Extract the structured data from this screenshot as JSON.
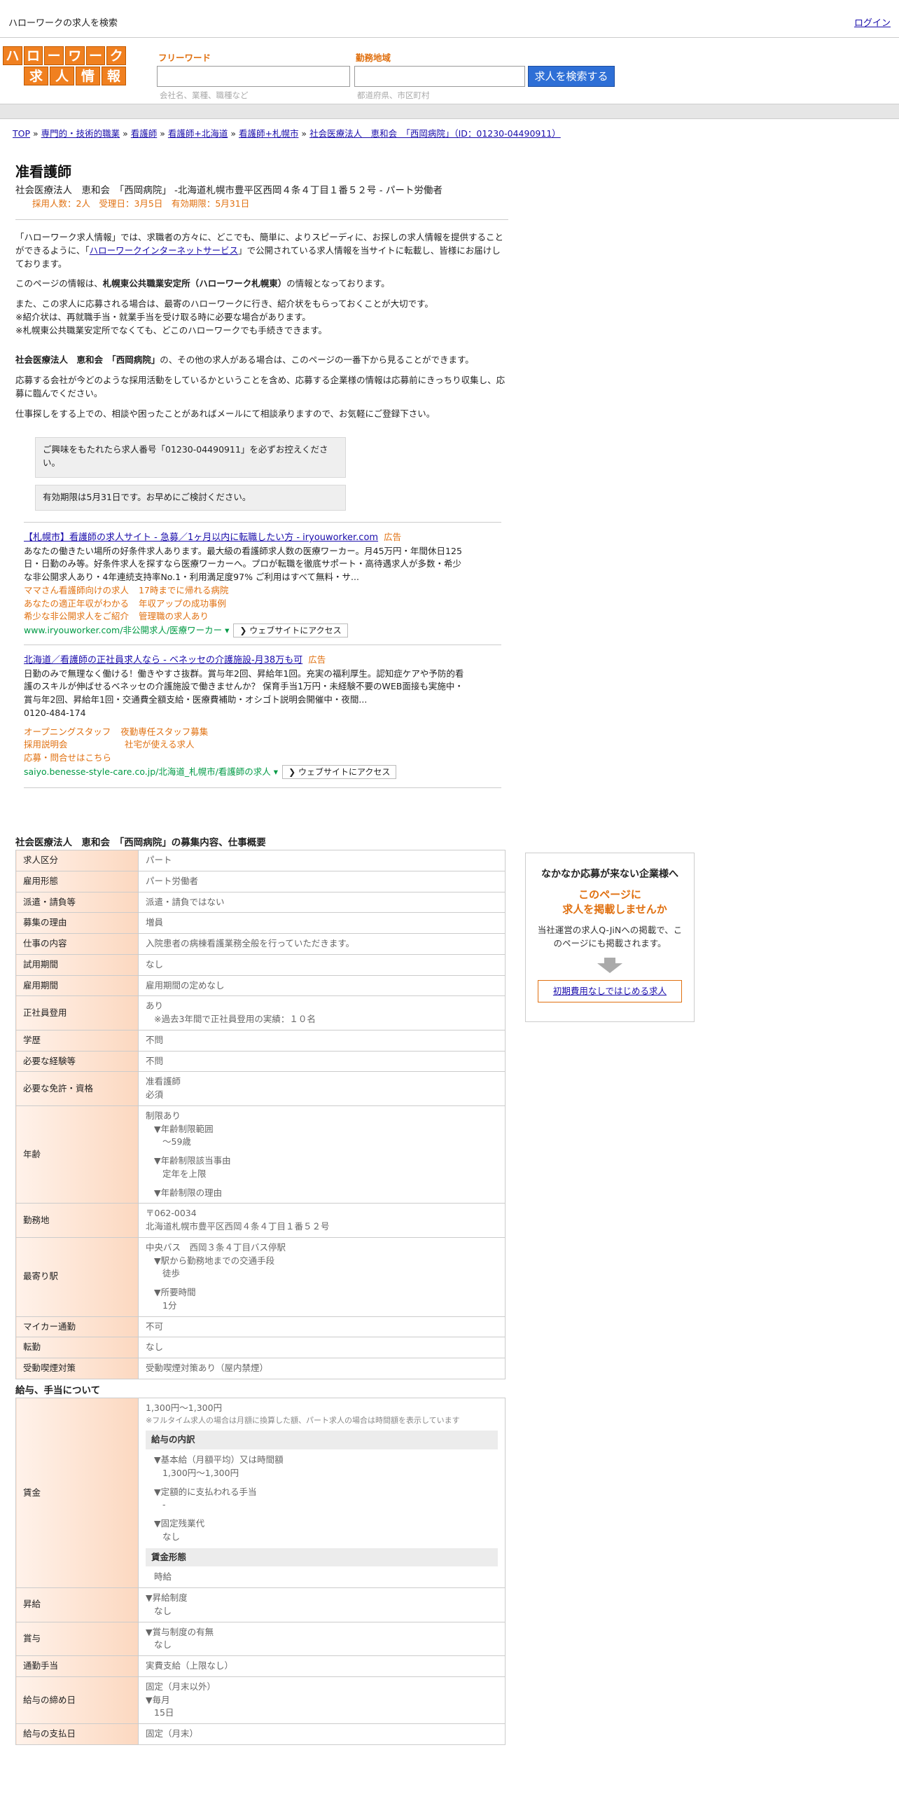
{
  "header": {
    "site_title": "ハローワークの求人を検索",
    "login": "ログイン"
  },
  "logo": {
    "row1": [
      "ハ",
      "ロ",
      "ー",
      "ワ",
      "ー",
      "ク"
    ],
    "row2": [
      "求",
      "人",
      "情",
      "報"
    ]
  },
  "search": {
    "keyword_label": "フリーワード",
    "keyword_hint": "会社名、業種、職種など",
    "area_label": "勤務地域",
    "area_hint": "都道府県、市区町村",
    "button": "求人を検索する"
  },
  "breadcrumb": [
    "TOP",
    "専門的・技術的職業",
    "看護師",
    "看護師+北海道",
    "看護師+札幌市",
    "社会医療法人　恵和会　「西岡病院」（ID：01230-04490911）"
  ],
  "job": {
    "title": "准看護師",
    "subtitle": "社会医療法人　恵和会　「西岡病院」 -北海道札幌市豊平区西岡４条４丁目１番５２号 - パート労働者",
    "meta": "採用人数：2人　受理日：3月5日　有効期限：5月31日"
  },
  "intro": {
    "p1a": "「ハローワーク求人情報」では、求職者の方々に、どこでも、簡単に、よりスピーディに、お探しの求人情報を提供することができるように、「",
    "p1link": "ハローワークインターネットサービス",
    "p1b": "」で公開されている求人情報を当サイトに転載し、皆様にお届けしております。",
    "p2a": "このページの情報は、",
    "p2b": "札幌東公共職業安定所（ハローワーク札幌東）",
    "p2c": "の情報となっております。",
    "p3": "また、この求人に応募される場合は、最寄のハローワークに行き、紹介状をもらっておくことが大切です。",
    "p4": "※紹介状は、再就職手当・就業手当を受け取る時に必要な場合があります。",
    "p5": "※札幌東公共職業安定所でなくても、どこのハローワークでも手続きできます。",
    "p6a": "社会医療法人　恵和会　「西岡病院」",
    "p6b": "の、その他の求人がある場合は、このページの一番下から見ることができます。",
    "p7": "応募する会社が今どのような採用活動をしているかということを含め、応募する企業様の情報は応募前にきっちり収集し、応募に臨んでください。",
    "p8": "仕事探しをする上での、相談や困ったことがあればメールにて相談承りますので、お気軽にご登録下さい。",
    "note1": "ご興味をもたれたら求人番号「01230-04490911」を必ずお控えください。",
    "note2": "有効期限は5月31日です。お早めにご検討ください。"
  },
  "ads": [
    {
      "title": "【札幌市】看護師の求人サイト - 急募／1ヶ月以内に転職したい方 - iryouworker.com",
      "tag": "広告",
      "desc": "あなたの働きたい場所の好条件求人あります。最大級の看護師求人数の医療ワーカー。月45万円・年間休日125日・日勤のみ等。好条件求人を探すなら医療ワーカーへ。プロが転職を徹底サポート・高待遇求人が多数・希少な非公開求人あり・4年連続支持率No.1・利用満足度97% ご利用はすべて無料・サ...",
      "links": [
        "ママさん看護師向けの求人",
        "17時までに帰れる病院",
        "あなたの適正年収がわかる",
        "年収アップの成功事例",
        "希少な非公開求人をご紹介",
        "管理職の求人あり"
      ],
      "url": "www.iryouworker.com/非公開求人/医療ワーカー",
      "visit": "ウェブサイトにアクセス"
    },
    {
      "title": "北海道／看護師の正社員求人なら - ベネッセの介護施設-月38万も可",
      "tag": "広告",
      "desc": "日勤のみで無理なく働ける！働きやすさ抜群。賞与年2回、昇給年1回。充実の福利厚生。認知症ケアや予防的看護のスキルが伸ばせるベネッセの介護施設で働きませんか？ 保育手当1万円・未経験不要のWEB面接も実施中・賞与年2回、昇給年1回・交通費全額支給・医療費補助・オシゴト説明会開催中・夜間...",
      "phone": "0120-484-174",
      "links": [
        "オープニングスタッフ",
        "夜勤専任スタッフ募集",
        "採用説明会",
        "社宅が使える求人",
        "応募・問合せはこちら"
      ],
      "url": "saiyo.benesse-style-care.co.jp/北海道_札幌市/看護師の求人",
      "visit": "ウェブサイトにアクセス"
    }
  ],
  "overview": {
    "heading": "社会医療法人　恵和会　「西岡病院」の募集内容、仕事概要",
    "rows": [
      {
        "k": "求人区分",
        "v": "パート"
      },
      {
        "k": "雇用形態",
        "v": "パート労働者"
      },
      {
        "k": "派遣・請負等",
        "v": "派遣・請負ではない"
      },
      {
        "k": "募集の理由",
        "v": "増員"
      },
      {
        "k": "仕事の内容",
        "v": "入院患者の病棟看護業務全般を行っていただきます。"
      },
      {
        "k": "試用期間",
        "v": "なし"
      },
      {
        "k": "雇用期間",
        "v": "雇用期間の定めなし"
      },
      {
        "k": "正社員登用",
        "v": "あり",
        "v2": "※過去3年間で正社員登用の実績：１０名"
      },
      {
        "k": "学歴",
        "v": "不問"
      },
      {
        "k": "必要な経験等",
        "v": "不問"
      },
      {
        "k": "必要な免許・資格",
        "v": "准看護師",
        "v2": "必須"
      },
      {
        "k": "年齢",
        "v": "制限あり",
        "l1": "▼年齢制限範囲",
        "l1v": "〜59歳",
        "l2": "▼年齢制限該当事由",
        "l2v": "定年を上限",
        "l3": "▼年齢制限の理由"
      },
      {
        "k": "勤務地",
        "v": "〒062-0034",
        "v2": "北海道札幌市豊平区西岡４条４丁目１番５２号"
      },
      {
        "k": "最寄り駅",
        "v": "中央バス　西岡３条４丁目バス停駅",
        "l1": "▼駅から勤務地までの交通手段",
        "l1v": "徒歩",
        "l2": "▼所要時間",
        "l2v": "1分"
      },
      {
        "k": "マイカー通勤",
        "v": "不可"
      },
      {
        "k": "転勤",
        "v": "なし"
      },
      {
        "k": "受動喫煙対策",
        "v": "受動喫煙対策あり（屋内禁煙）"
      }
    ]
  },
  "salary": {
    "heading": "給与、手当について",
    "wage_key": "賃金",
    "wage_range": "1,300円〜1,300円",
    "wage_note": "※フルタイム求人の場合は月額に換算した額、パート求人の場合は時間額を表示しています",
    "breakdown_h": "給与の内訳",
    "base_label": "▼基本給（月額平均）又は時間額",
    "base_value": "1,300円〜1,300円",
    "fixed_label": "▼定額的に支払われる手当",
    "fixed_value": "-",
    "ot_label": "▼固定残業代",
    "ot_value": "なし",
    "form_h": "賃金形態",
    "form_value": "時給",
    "rows": [
      {
        "k": "昇給",
        "l": "▼昇給制度",
        "v": "なし"
      },
      {
        "k": "賞与",
        "l": "▼賞与制度の有無",
        "v": "なし"
      },
      {
        "k": "通勤手当",
        "v": "実費支給（上限なし）"
      },
      {
        "k": "給与の締め日",
        "v": "固定（月末以外）",
        "l": "▼毎月",
        "lv": "15日"
      },
      {
        "k": "給与の支払日",
        "v": "固定（月末）"
      }
    ]
  },
  "side": {
    "heading": "なかなか応募が来ない企業様へ",
    "orange1": "このページに",
    "orange2": "求人を掲載しませんか",
    "body": "当社運営の求人Q-JiNへの掲載で、このページにも掲載されます。",
    "button": "初期費用なしではじめる求人"
  }
}
